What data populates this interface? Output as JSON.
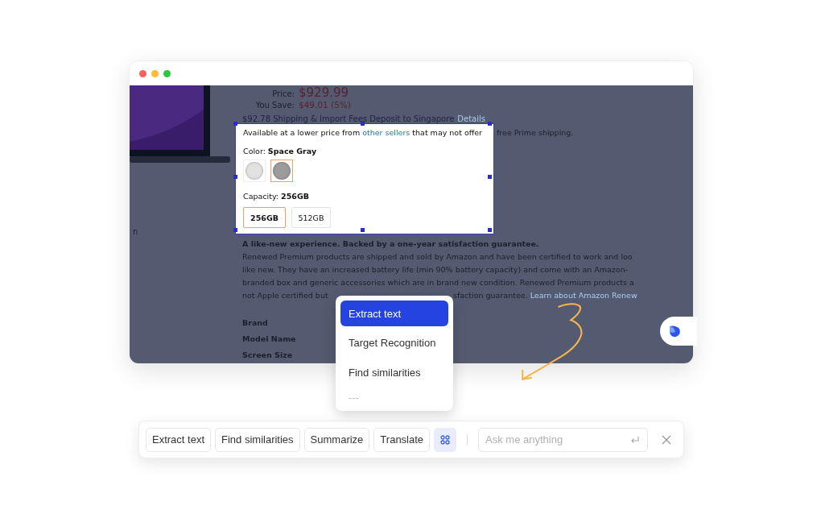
{
  "window": {
    "controls": [
      {
        "color": "#ff5f57"
      },
      {
        "color": "#febc2e"
      },
      {
        "color": "#28c840"
      }
    ]
  },
  "product": {
    "price_label": "Price:",
    "price": "$929.99",
    "save_label": "You Save:",
    "save": "$49.01 (5%)",
    "shipping": "$92.78 Shipping & Import Fees Deposit to Singapore",
    "shipping_link": "Details",
    "left_edge_text": "n",
    "selection": {
      "availability_start": "Available at a lower price from",
      "availability_link": "other sellers",
      "availability_end": "that may not offer",
      "availability_rest": "free Prime shipping.",
      "color_label": "Color: **Space Gray**",
      "swatches": [
        {
          "color": "#e2e2e2",
          "selected": false
        },
        {
          "color": "#9c9c9c",
          "selected": true
        }
      ],
      "capacity_label": "Capacity: **256GB**",
      "capacities": [
        {
          "label": "256GB",
          "selected": true
        },
        {
          "label": "512GB",
          "selected": false
        }
      ]
    },
    "headline": "A like-new experience. Backed by a one-year satisfaction guarantee.",
    "paragraph_lines": [
      "Renewed Premium products are shipped and sold by Amazon and have been certified to work and loo",
      "like new. They have an increased battery life (min 90% battery capacity) and come with an Amazon-",
      "branded box and generic accessories which are in brand new condition. Renewed Premium products a"
    ],
    "last_line": {
      "start": "not Apple certified but",
      "end": "sfaction guarantee.",
      "link": "Learn about Amazon Renew"
    },
    "specs": [
      "Brand",
      "Model Name",
      "Screen Size"
    ]
  },
  "menu": {
    "items": [
      {
        "kind": "action",
        "label": "Extract text",
        "selected": true
      },
      {
        "kind": "action",
        "label": "Target Recognition",
        "selected": false
      },
      {
        "kind": "action",
        "label": "Find similarities",
        "selected": false
      },
      {
        "kind": "more",
        "label": "---",
        "selected": false
      }
    ]
  },
  "toolbar": {
    "buttons": [
      "Extract text",
      "Find similarities",
      "Summarize",
      "Translate"
    ],
    "input": {
      "placeholder": "Ask me anything"
    }
  }
}
